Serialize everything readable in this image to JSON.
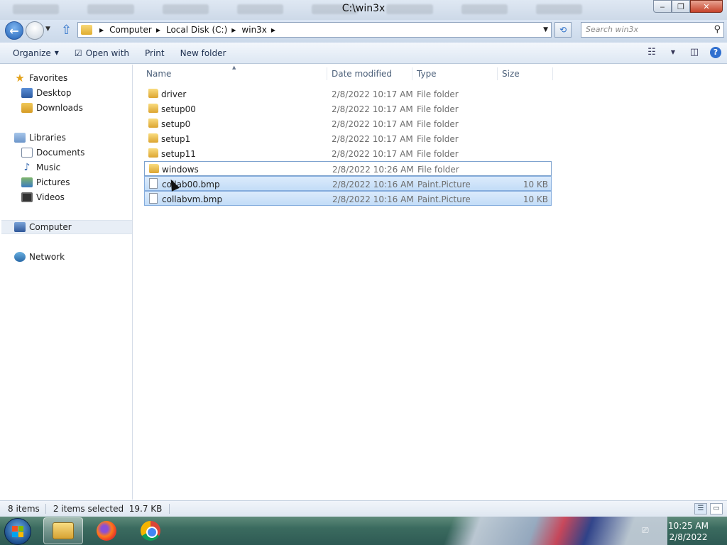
{
  "window": {
    "title": "C:\\win3x",
    "minimize_symbol": "‒",
    "maximize_symbol": "❐",
    "close_symbol": "✕"
  },
  "address": {
    "breadcrumbs": [
      "Computer",
      "Local Disk (C:)",
      "win3x"
    ],
    "search_placeholder": "Search win3x"
  },
  "toolbar": {
    "organize_label": "Organize",
    "open_with_label": "Open with",
    "print_label": "Print",
    "new_folder_label": "New folder"
  },
  "nav": {
    "favorites_label": "Favorites",
    "desktop_label": "Desktop",
    "downloads_label": "Downloads",
    "libraries_label": "Libraries",
    "documents_label": "Documents",
    "music_label": "Music",
    "pictures_label": "Pictures",
    "videos_label": "Videos",
    "computer_label": "Computer",
    "network_label": "Network",
    "selected": "Computer"
  },
  "columns": {
    "name": "Name",
    "date": "Date modified",
    "type": "Type",
    "size": "Size"
  },
  "files": [
    {
      "name": "driver",
      "date": "2/8/2022 10:17 AM",
      "type": "File folder",
      "size": "",
      "kind": "folder"
    },
    {
      "name": "setup00",
      "date": "2/8/2022 10:17 AM",
      "type": "File folder",
      "size": "",
      "kind": "folder"
    },
    {
      "name": "setup0",
      "date": "2/8/2022 10:17 AM",
      "type": "File folder",
      "size": "",
      "kind": "folder"
    },
    {
      "name": "setup1",
      "date": "2/8/2022 10:17 AM",
      "type": "File folder",
      "size": "",
      "kind": "folder"
    },
    {
      "name": "setup11",
      "date": "2/8/2022 10:17 AM",
      "type": "File folder",
      "size": "",
      "kind": "folder"
    },
    {
      "name": "windows",
      "date": "2/8/2022 10:26 AM",
      "type": "File folder",
      "size": "",
      "kind": "folder"
    },
    {
      "name": "collab00.bmp",
      "date": "2/8/2022 10:16 AM",
      "type": "Paint.Picture",
      "size": "10 KB",
      "kind": "file"
    },
    {
      "name": "collabvm.bmp",
      "date": "2/8/2022 10:16 AM",
      "type": "Paint.Picture",
      "size": "10 KB",
      "kind": "file"
    }
  ],
  "status": {
    "item_count": "8 items",
    "selection": "2 items selected",
    "selection_size": "19.7 KB"
  },
  "taskbar": {
    "time": "10:25 AM",
    "date": "2/8/2022"
  },
  "colors": {
    "selection_fill": "#cce4fb",
    "selection_border": "#84acdd",
    "accent": "#2a6fc9"
  }
}
